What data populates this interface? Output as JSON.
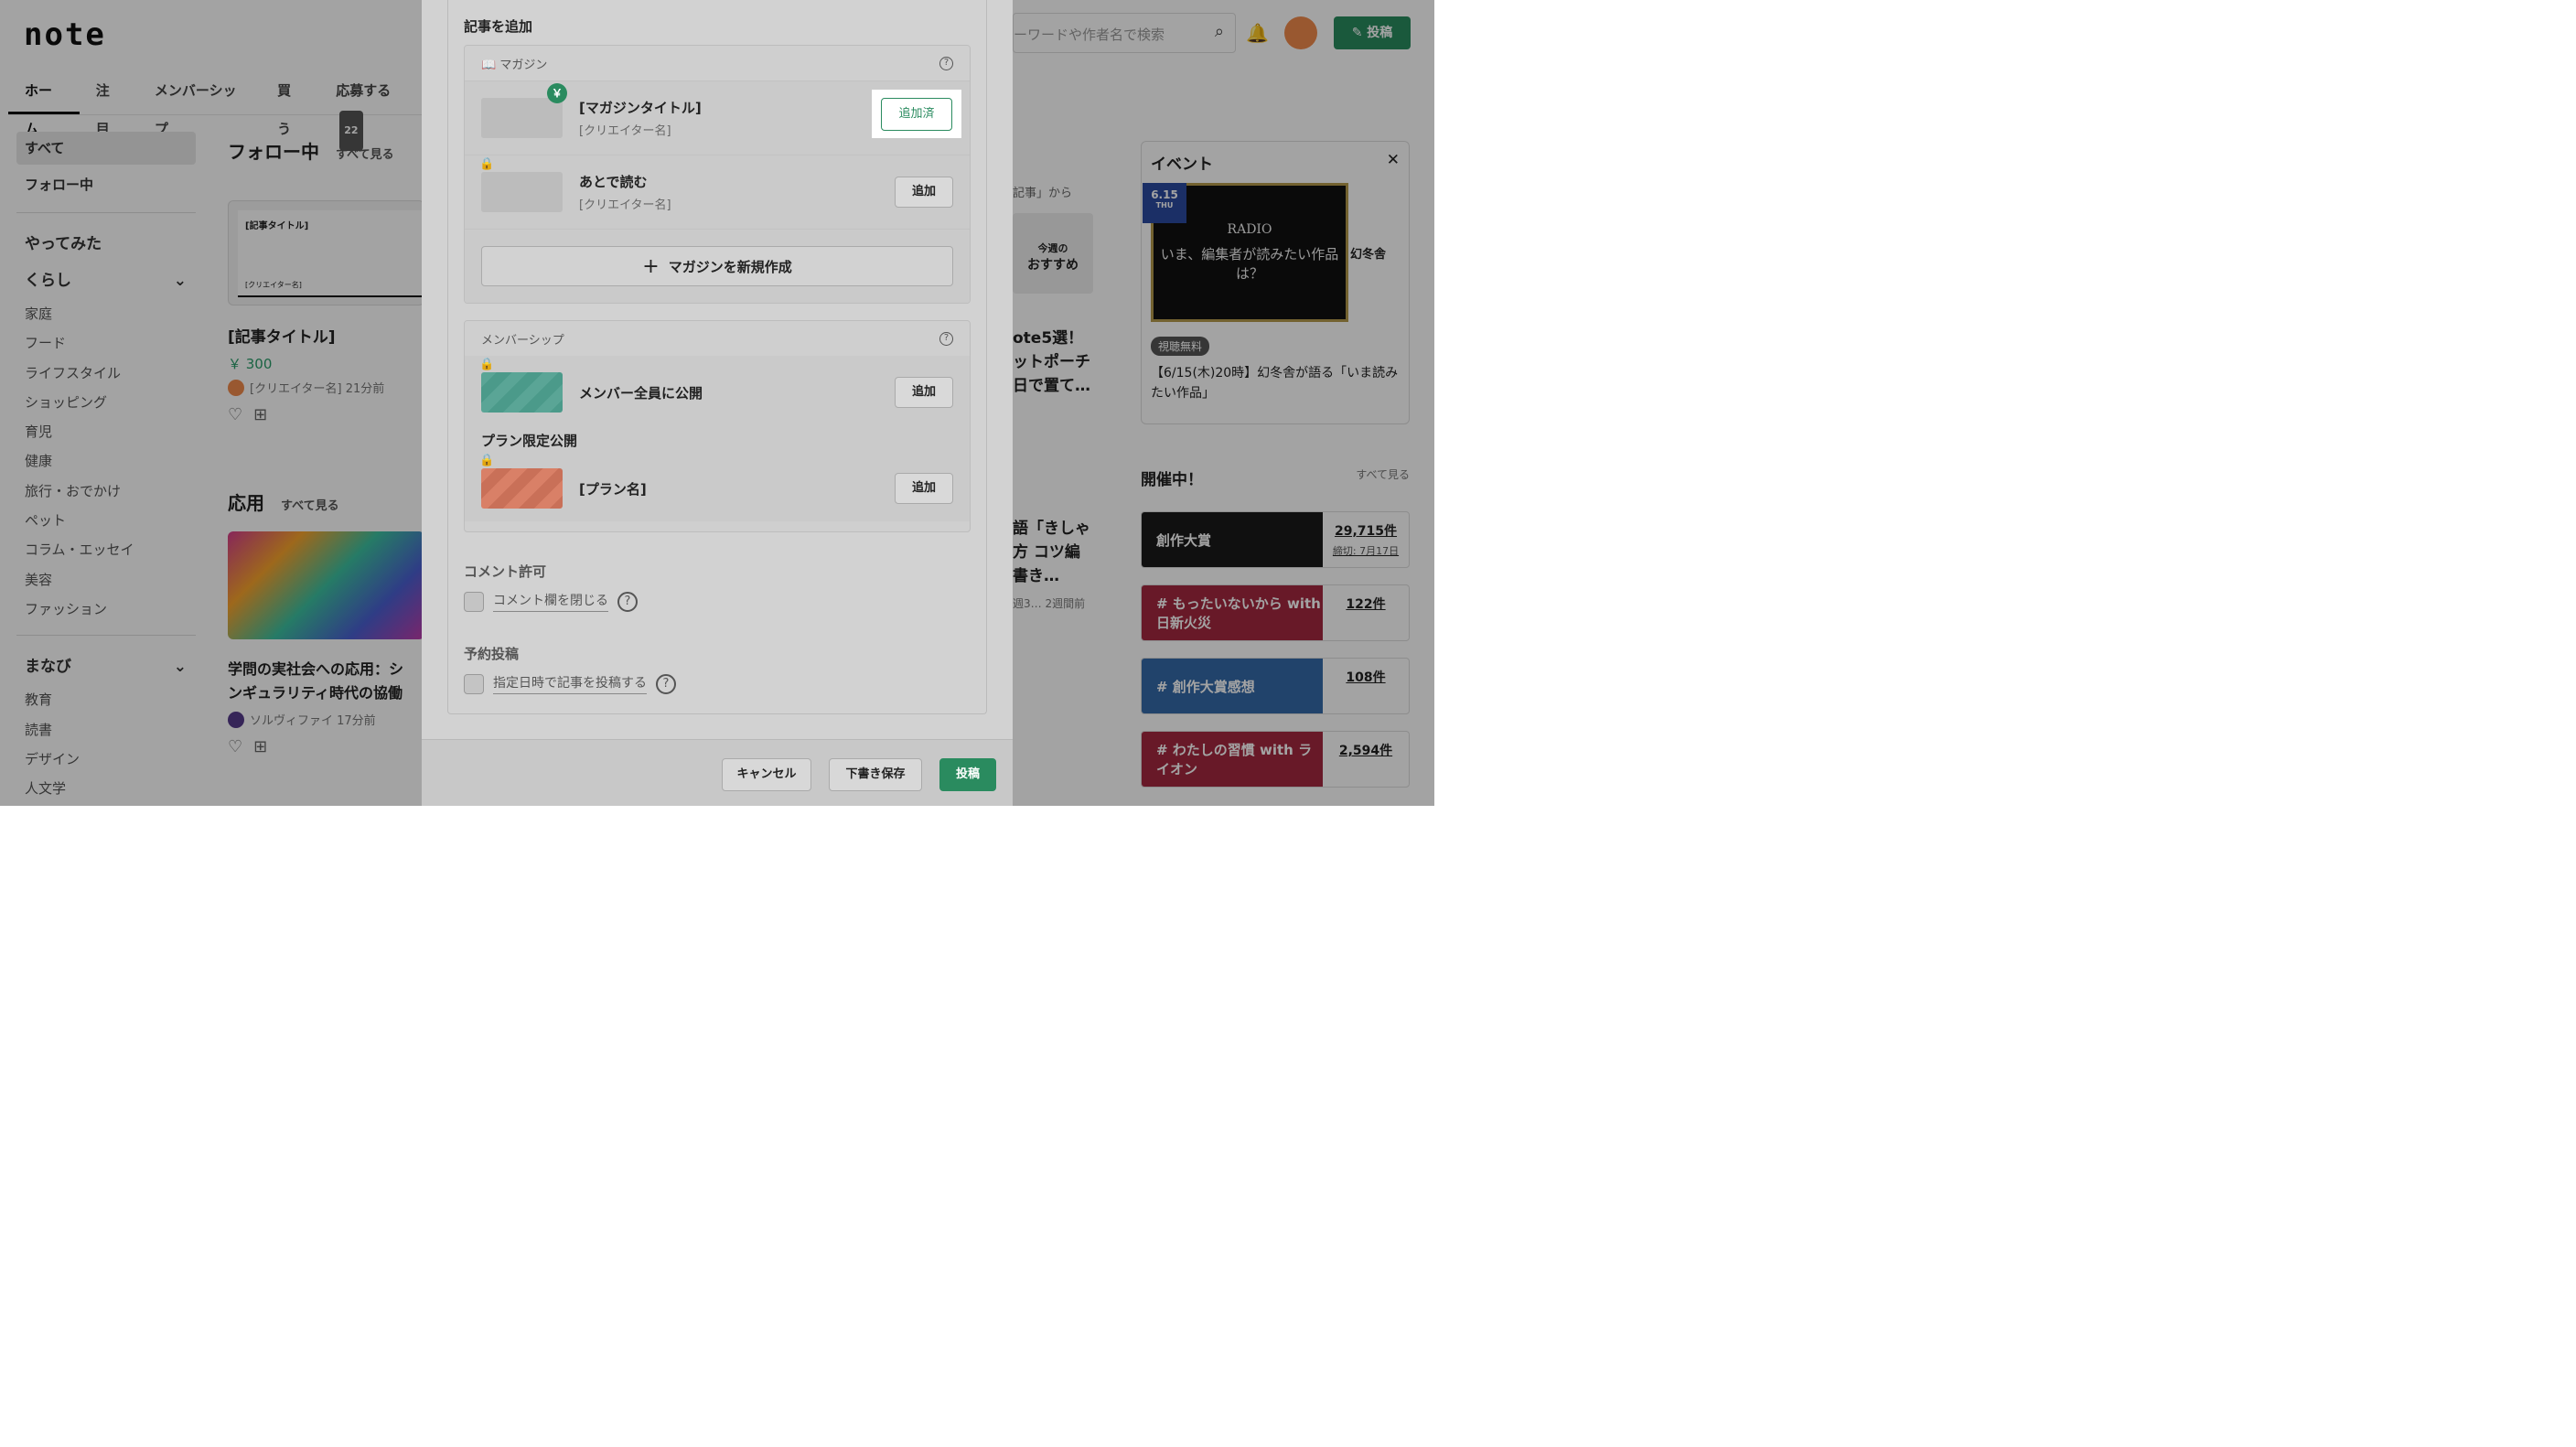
{
  "header": {
    "logo": "note",
    "search_placeholder": "ーワードや作者名で検索",
    "post_label": "✎ 投稿"
  },
  "nav": {
    "tabs": [
      "ホーム",
      "注目",
      "メンバーシップ",
      "買う",
      "応募する"
    ],
    "badge": "22"
  },
  "sidebar": {
    "all": "すべて",
    "following": "フォロー中",
    "tried": "やってみた",
    "kurashi": "くらし",
    "kurashi_items": [
      "家庭",
      "フード",
      "ライフスタイル",
      "ショッピング",
      "育児",
      "健康",
      "旅行・おでかけ",
      "ペット",
      "コラム・エッセイ",
      "美容",
      "ファッション"
    ],
    "manabi": "まなび",
    "manabi_items": [
      "教育",
      "読書",
      "デザイン",
      "人文学"
    ]
  },
  "feed": {
    "following_title": "フォロー中",
    "see_all": "すべて見る",
    "card_thumb_title": "[記事タイトル]",
    "card_thumb_creator": "[クリエイター名]",
    "card_title": "[記事タイトル]",
    "price": "￥ 300",
    "card_meta": "[クリエイター名] 21分前",
    "apply_title": "応用",
    "apply_see_all": "すべて見る",
    "card2_title_1": "学問の実社会への応用：シ",
    "card2_title_2": "ンギュラリティ時代の協働",
    "card2_meta": "ソルヴィファイ 17分前"
  },
  "midcol": {
    "from": "記事」から",
    "weekly_1": "今週の",
    "weekly_2": "おすすめ",
    "title_1": "ote5選！",
    "title_2": "ットポーチ",
    "title_3": "日で置て…",
    "b_1": "語「きしゃ",
    "b_2": "方 コツ編",
    "b_3": "書き…",
    "b_meta": "週3… 2週間前"
  },
  "event": {
    "title": "イベント",
    "date": "6.15",
    "day": "THU",
    "radio": "RADIO",
    "img_text": "いま、編集者が読みたい作品は？",
    "publisher": "幻冬舎",
    "free_tag": "視聴無料",
    "desc": "【6/15(木)20時】幻冬舎が語る「いま読みたい作品」"
  },
  "ongoing": {
    "title": "開催中！",
    "see_all": "すべて見る",
    "banners": [
      {
        "label": "創作大賞",
        "count": "29,715件",
        "sub": "締切: 7月17日",
        "color": "#1a1a1a"
      },
      {
        "label": "# もったいないから with 日新火災",
        "count": "122件",
        "sub": "",
        "color": "#a3283f"
      },
      {
        "label": "# 創作大賞感想",
        "count": "108件",
        "sub": "",
        "color": "#3569a8"
      },
      {
        "label": "# わたしの習慣 with ライオン",
        "count": "2,594件",
        "sub": "",
        "color": "#a3283f"
      }
    ]
  },
  "modal": {
    "title": "記事を追加",
    "magazine": {
      "head": "マガジン",
      "rows": [
        {
          "title": "[マガジンタイトル]",
          "creator": "[クリエイター名]",
          "button": "追加済"
        },
        {
          "title": "あとで読む",
          "creator": "[クリエイター名]",
          "button": "追加"
        }
      ],
      "create": "マガジンを新規作成"
    },
    "membership": {
      "head": "メンバーシップ",
      "all_members": "メンバー全員に公開",
      "all_button": "追加",
      "plan_label": "プラン限定公開",
      "plan_name": "[プラン名]",
      "plan_button": "追加"
    },
    "comment": {
      "title": "コメント許可",
      "option": "コメント欄を閉じる"
    },
    "schedule": {
      "title": "予約投稿",
      "option": "指定日時で記事を投稿する"
    },
    "footer": {
      "cancel": "キャンセル",
      "draft": "下書き保存",
      "post": "投稿"
    }
  }
}
